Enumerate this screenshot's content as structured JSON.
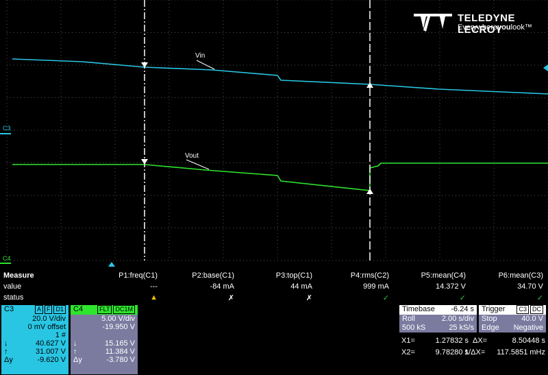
{
  "brand": {
    "name": "TELEDYNE LECROY",
    "tagline_pre": "Everywhere",
    "tagline_bold": "you",
    "tagline_post": "look",
    "tm": "™"
  },
  "traces": {
    "vin_label": "Vin",
    "vout_label": "Vout",
    "c3_marker": "C3",
    "c4_marker": "C4"
  },
  "colors": {
    "c3": "#29c6e4",
    "c4": "#2ee62e",
    "grid": "#555555",
    "panel": "#7b7ba0",
    "c3_panel": "#29c6e4",
    "c4_panel": "#2ee62e"
  },
  "measure": {
    "title": "Measure",
    "row_labels": [
      "value",
      "status"
    ],
    "params": [
      {
        "name": "P1:freq(C1)",
        "value": "---",
        "status": "warning"
      },
      {
        "name": "P2:base(C1)",
        "value": "-84 mA",
        "status": "cross"
      },
      {
        "name": "P3:top(C1)",
        "value": "44 mA",
        "status": "cross"
      },
      {
        "name": "P4:rms(C2)",
        "value": "999 mA",
        "status": "check"
      },
      {
        "name": "P5:mean(C4)",
        "value": "14.372 V",
        "status": "check"
      },
      {
        "name": "P6:mean(C3)",
        "value": "34.70 V",
        "status": "check"
      }
    ]
  },
  "c3_box": {
    "label": "C3",
    "tags": [
      "A",
      "F",
      "D1"
    ],
    "vdiv": "20.0 V/div",
    "offset": "0 mV offset",
    "count": "1 #",
    "down_label": "↓",
    "down_value": "40.627 V",
    "up_label": "↑",
    "up_value": "31.007 V",
    "dy_label": "Δy",
    "dy_value": "-9.620 V"
  },
  "c4_box": {
    "label": "C4",
    "tags": [
      "FLT",
      "DC1M"
    ],
    "vdiv": "5.00 V/div",
    "offset": "-19.950 V",
    "down_label": "↓",
    "down_value": "15.165 V",
    "up_label": "↑",
    "up_value": "11.384 V",
    "dy_label": "Δy",
    "dy_value": "-3.780 V"
  },
  "timebase": {
    "title": "Timebase",
    "value": "-6.24 s",
    "mode": "Roll",
    "sdiv": "2.00 s/div",
    "samples": "500 kS",
    "rate": "25 kS/s"
  },
  "trigger": {
    "title": "Trigger",
    "tags": [
      "C3",
      "DC"
    ],
    "mode": "Stop",
    "level": "40.0 V",
    "type": "Edge",
    "slope": "Negative"
  },
  "cursors": {
    "x1_label": "X1=",
    "x1": "1.27832 s",
    "dx_label": "ΔX=",
    "dx": "8.50448 s",
    "x2_label": "X2=",
    "x2": "9.78280 s",
    "inv_label": "1/ΔX=",
    "inv": "117.5851 mHz"
  }
}
